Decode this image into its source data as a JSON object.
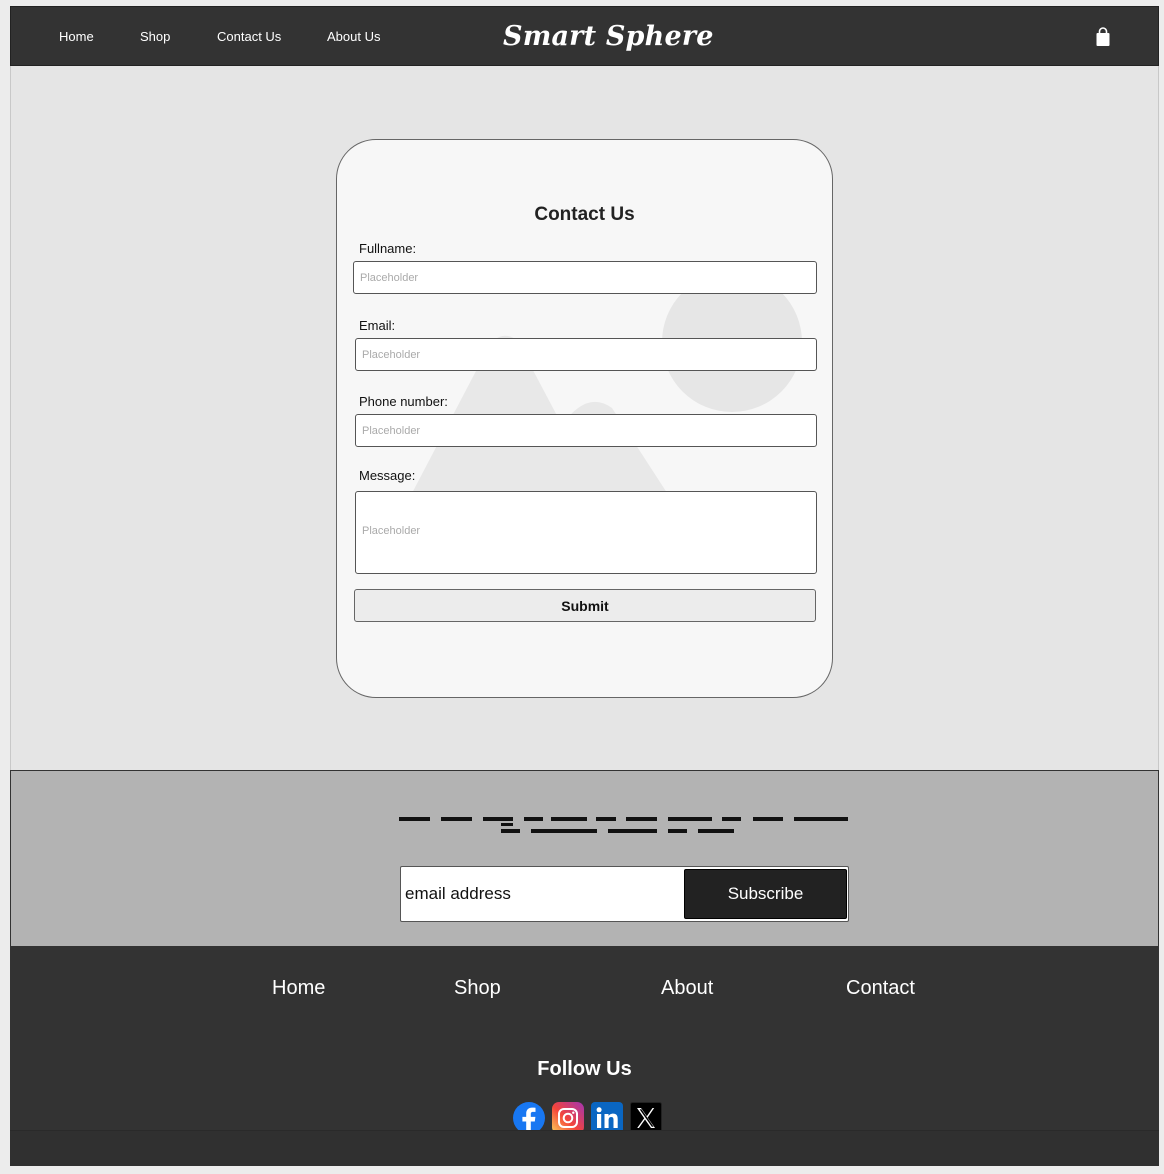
{
  "header": {
    "nav": [
      "Home",
      "Shop",
      "Contact Us",
      "About Us"
    ],
    "brand": "Smart Sphere",
    "cart_icon": "shopping-bag-icon"
  },
  "contact_form": {
    "title": "Contact Us",
    "fields": [
      {
        "label": "Fullname:",
        "placeholder": "Placeholder",
        "value": ""
      },
      {
        "label": "Email:",
        "placeholder": "Placeholder",
        "value": ""
      },
      {
        "label": "Phone number:",
        "placeholder": "Placeholder",
        "value": ""
      },
      {
        "label": "Message:",
        "placeholder": "Placeholder",
        "value": ""
      }
    ],
    "submit_label": "Submit"
  },
  "newsletter": {
    "email_placeholder": "email address",
    "subscribe_label": "Subscribe"
  },
  "footer": {
    "links": [
      "Home",
      "Shop",
      "About",
      "Contact"
    ],
    "follow_title": "Follow Us",
    "social_icons": [
      "facebook-icon",
      "instagram-icon",
      "linkedin-icon",
      "x-icon"
    ]
  },
  "colors": {
    "header_bg": "#333333",
    "page_bg": "#e5e5e5",
    "card_bg": "#f7f7f7",
    "newsletter_bg": "#b3b3b3",
    "button_dark": "#222222",
    "footer_bg": "#333333"
  }
}
